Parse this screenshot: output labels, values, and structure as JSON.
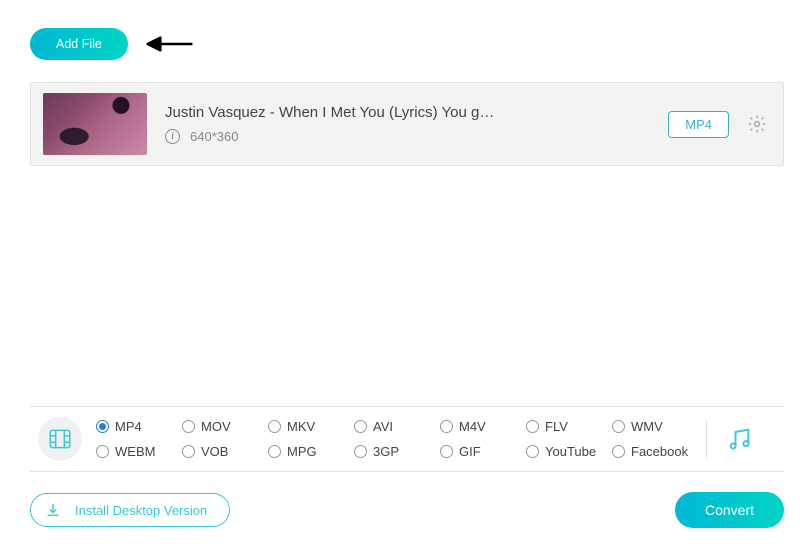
{
  "toolbar": {
    "add_file_label": "Add File"
  },
  "file": {
    "title": "Justin Vasquez - When I Met You (Lyrics) You g…",
    "resolution": "640*360",
    "output_format": "MP4"
  },
  "formats": {
    "selected": "MP4",
    "options": [
      "MP4",
      "MOV",
      "MKV",
      "AVI",
      "M4V",
      "FLV",
      "WMV",
      "WEBM",
      "VOB",
      "MPG",
      "3GP",
      "GIF",
      "YouTube",
      "Facebook"
    ]
  },
  "bottom": {
    "install_label": "Install Desktop Version",
    "convert_label": "Convert"
  }
}
